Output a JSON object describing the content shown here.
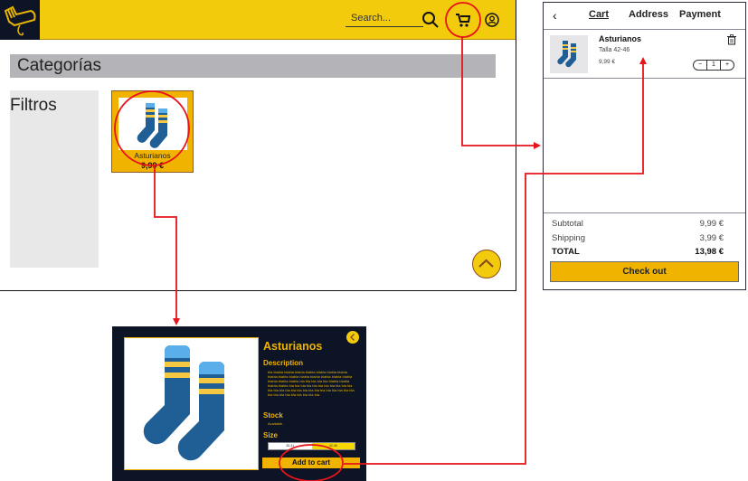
{
  "shop": {
    "search_placeholder": "Search...",
    "categories_label": "Categorías",
    "filters_label": "Filtros",
    "product": {
      "name": "Asturianos",
      "price": "9,99 €"
    },
    "icons": [
      "logo-icon",
      "search-icon",
      "cart-icon",
      "user-icon",
      "chevron-up-icon"
    ]
  },
  "cart": {
    "back_icon": "‹",
    "tabs": [
      {
        "label": "Cart",
        "active": true
      },
      {
        "label": "Address",
        "active": false
      },
      {
        "label": "Payment",
        "active": false
      }
    ],
    "item": {
      "name": "Asturianos",
      "size": "Talla 42-46",
      "price": "9,99 €",
      "quantity": "1",
      "minus": "−",
      "plus": "+"
    },
    "summary": {
      "subtotal_label": "Subtotal",
      "subtotal_value": "9,99 €",
      "shipping_label": "Shipping",
      "shipping_value": "3,99 €",
      "total_label": "TOTAL",
      "total_value": "13,98 €"
    },
    "checkout_label": "Check out"
  },
  "detail": {
    "title": "Asturianos",
    "description_heading": "Description",
    "description_text": "bla blabla blabla blabla blabla blabla blabla blabla blabla blabla blabla blabla blabla blabla blabla blabla blabla blabla blabla bla bla bla bla bla blabla blabla blabla blabla bla bla bla bla bla bla bla bla bla bla bla bla bla bla bla bla bla bla bla bla bla bla bla bla bla bla bla bla bla bla bla bla bla bla bla.",
    "stock_heading": "Stock",
    "stock_value": "Available.",
    "size_heading": "Size",
    "sizes": [
      "38-41",
      "42-46"
    ],
    "add_to_cart_label": "Add to cart"
  },
  "annotation": {
    "color": "#e8131b"
  },
  "colors": {
    "brand_yellow": "#f2cb0c",
    "button_yellow": "#f0b400",
    "navy": "#0d1426",
    "sock_light": "#5aaeea",
    "sock_dark": "#1f5f95",
    "stripe": "#f5c842"
  }
}
